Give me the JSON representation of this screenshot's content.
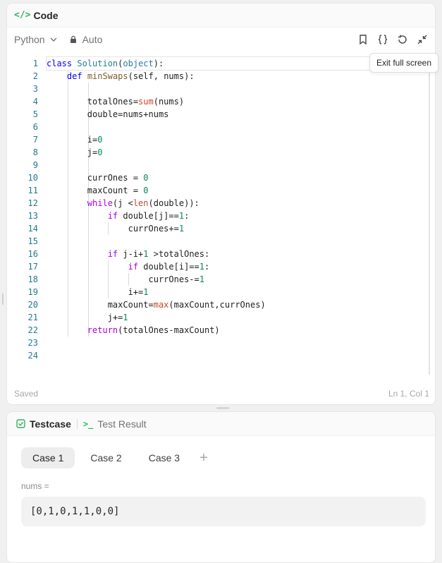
{
  "code_panel": {
    "title": "Code",
    "title_icon": "</>",
    "language": "Python",
    "mode": "Auto",
    "tooltip": "Exit full screen",
    "status_saved": "Saved",
    "status_cursor": "Ln 1, Col 1"
  },
  "icons": {
    "code": "code-brackets-icon",
    "chevron": "chevron-down-icon",
    "lock": "lock-icon",
    "bookmark": "bookmark-icon",
    "format": "braces-icon",
    "reset": "undo-icon",
    "collapse": "collapse-icon",
    "checkbox": "checkbox-icon",
    "terminal": "terminal-icon"
  },
  "code_lines": [
    "1",
    "2",
    "3",
    "4",
    "5",
    "6",
    "7",
    "8",
    "9",
    "10",
    "11",
    "12",
    "13",
    "14",
    "15",
    "16",
    "17",
    "18",
    "19",
    "20",
    "21",
    "22",
    "23",
    "24"
  ],
  "test_panel": {
    "tab_testcase": "Testcase",
    "tab_result": "Test Result",
    "term_glyph": ">_",
    "cases": [
      "Case 1",
      "Case 2",
      "Case 3"
    ],
    "add_symbol": "+",
    "param_label": "nums =",
    "param_value": "[0,1,0,1,1,0,0]"
  },
  "colors": {
    "accent_green": "#2fb55d",
    "keyword": "#0000ff",
    "control": "#af00db",
    "number": "#098658",
    "line_number": "#237893"
  }
}
